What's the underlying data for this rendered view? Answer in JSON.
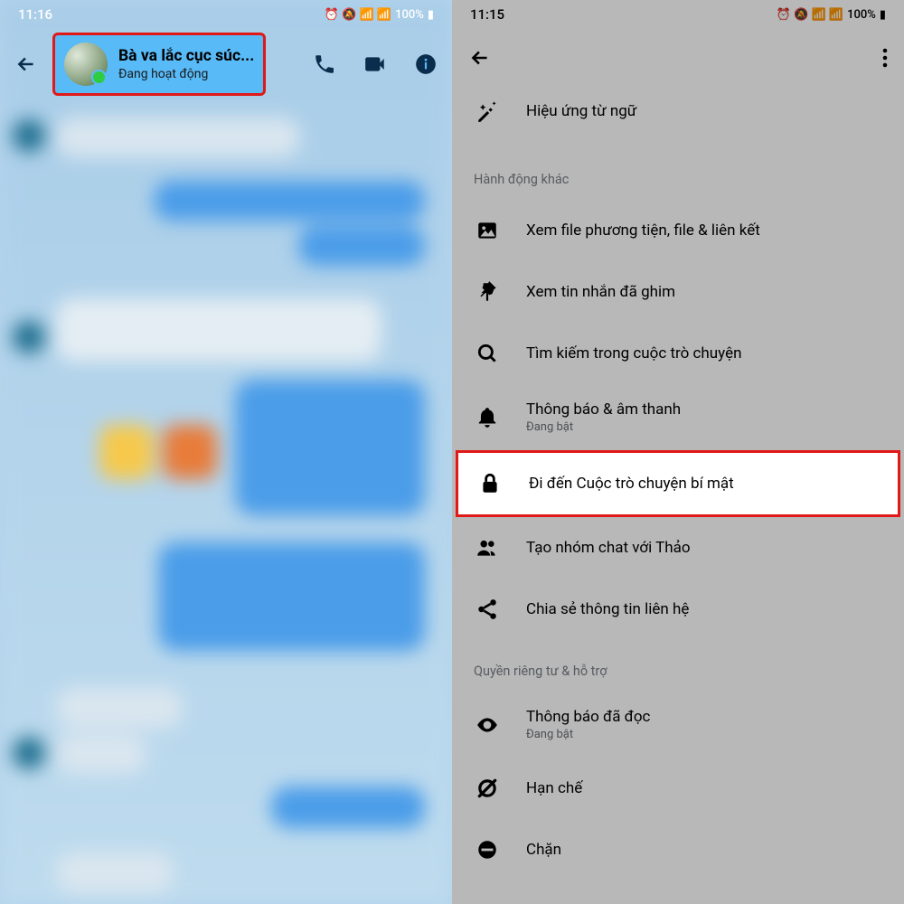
{
  "left": {
    "status": {
      "time": "11:16",
      "battery": "100%"
    },
    "profile": {
      "name": "Bà va lắc cục súc...",
      "status": "Đang hoạt động"
    }
  },
  "right": {
    "status": {
      "time": "11:15",
      "battery": "100%"
    },
    "items": {
      "word_effects": "Hiệu ứng từ ngữ",
      "section_other": "Hành động khác",
      "view_media": "Xem file phương tiện, file & liên kết",
      "view_pinned": "Xem tin nhắn đã ghim",
      "search_in_conv": "Tìm kiếm trong cuộc trò chuyện",
      "notif_sound": "Thông báo & âm thanh",
      "notif_sound_sub": "Đang bật",
      "secret_conv": "Đi đến Cuộc trò chuyện bí mật",
      "create_group": "Tạo nhóm chat với Thảo",
      "share_contact": "Chia sẻ thông tin liên hệ",
      "section_privacy": "Quyền riêng tư & hỗ trợ",
      "read_receipts": "Thông báo đã đọc",
      "read_receipts_sub": "Đang bật",
      "restrict": "Hạn chế",
      "block": "Chặn"
    }
  }
}
